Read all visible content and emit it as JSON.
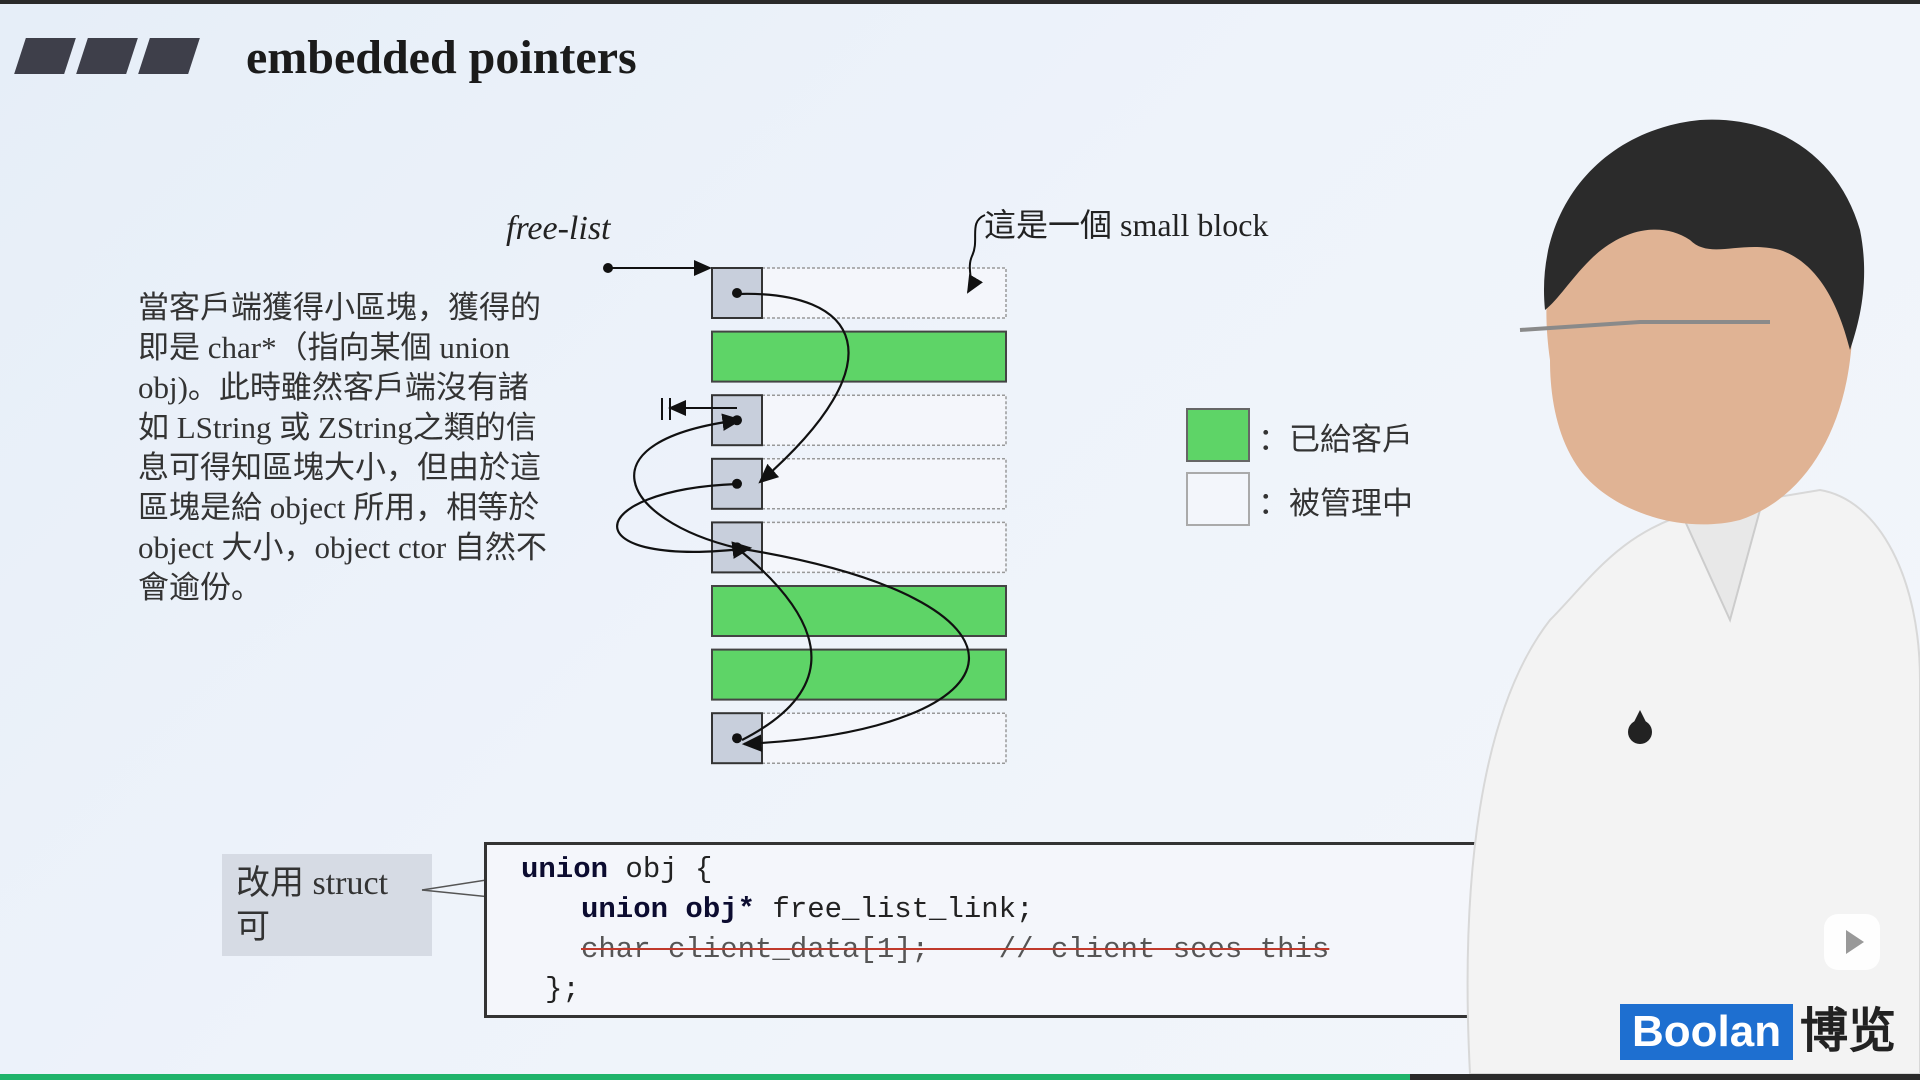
{
  "slide": {
    "title": "embedded pointers",
    "paragraph": [
      "當客戶端獲得小區塊，獲得的",
      "即是 char*（指向某個 union",
      "obj)。此時雖然客戶端沒有諸",
      "如 LString 或 ZString之類的信",
      "息可得知區塊大小，但由於這",
      "區塊是給 object 所用，相等於",
      "object 大小，object ctor 自然不",
      "會逾份。"
    ],
    "diagram": {
      "free_list_label": "free-list",
      "small_block_label": "這是一個 small block",
      "blocks": [
        "free",
        "client",
        "free",
        "free",
        "free",
        "client",
        "client",
        "free"
      ]
    },
    "legend": {
      "given_label": "：已給客戶",
      "managed_label": "：被管理中",
      "green_color": "#5ed467"
    },
    "note": {
      "line1": "改用 struct",
      "line2": "可"
    },
    "code": {
      "l1_kw": "union",
      "l1_rest": " obj {",
      "l2_kw": "union",
      "l2_mid": " obj*",
      "l2_rest": " free_list_link;",
      "l3": "char client_data[1];    // client sees this",
      "l4": "};"
    }
  },
  "branding": {
    "logo": "Boolan",
    "logo_cn": "博览"
  }
}
